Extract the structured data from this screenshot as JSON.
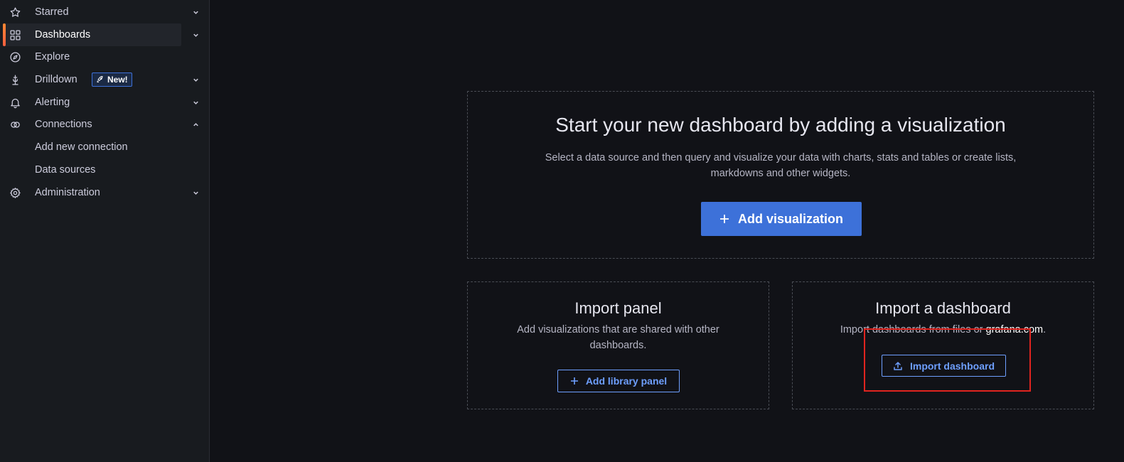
{
  "sidebar": {
    "items": [
      {
        "label": "Starred",
        "icon": "star-icon",
        "chevron": "down"
      },
      {
        "label": "Dashboards",
        "icon": "dashboards-grid-icon",
        "chevron": "down",
        "active": true
      },
      {
        "label": "Explore",
        "icon": "compass-icon"
      },
      {
        "label": "Drilldown",
        "icon": "drilldown-icon",
        "chevron": "down",
        "badge": "New!"
      },
      {
        "label": "Alerting",
        "icon": "bell-icon",
        "chevron": "down"
      },
      {
        "label": "Connections",
        "icon": "connections-icon",
        "chevron": "up"
      },
      {
        "label": "Add new connection",
        "sub": true
      },
      {
        "label": "Data sources",
        "sub": true
      },
      {
        "label": "Administration",
        "icon": "gear-icon",
        "chevron": "down"
      }
    ]
  },
  "main": {
    "visualization_card": {
      "title": "Start your new dashboard by adding a visualization",
      "description_line1": "Select a data source and then query and visualize your data with charts, stats and tables or create lists,",
      "description_line2": "markdowns and other widgets.",
      "button_label": "Add visualization"
    },
    "import_panel_card": {
      "title": "Import panel",
      "description_line1": "Add visualizations that are shared with other",
      "description_line2": "dashboards.",
      "button_label": "Add library panel"
    },
    "import_dashboard_card": {
      "title": "Import a dashboard",
      "description_prefix": "Import dashboards from files or ",
      "description_link": "grafana.com",
      "description_suffix": ".",
      "button_label": "Import dashboard"
    }
  },
  "colors": {
    "accent": "#3d71d9",
    "active_indicator": "#f55f3e",
    "highlight": "#e0241f"
  }
}
